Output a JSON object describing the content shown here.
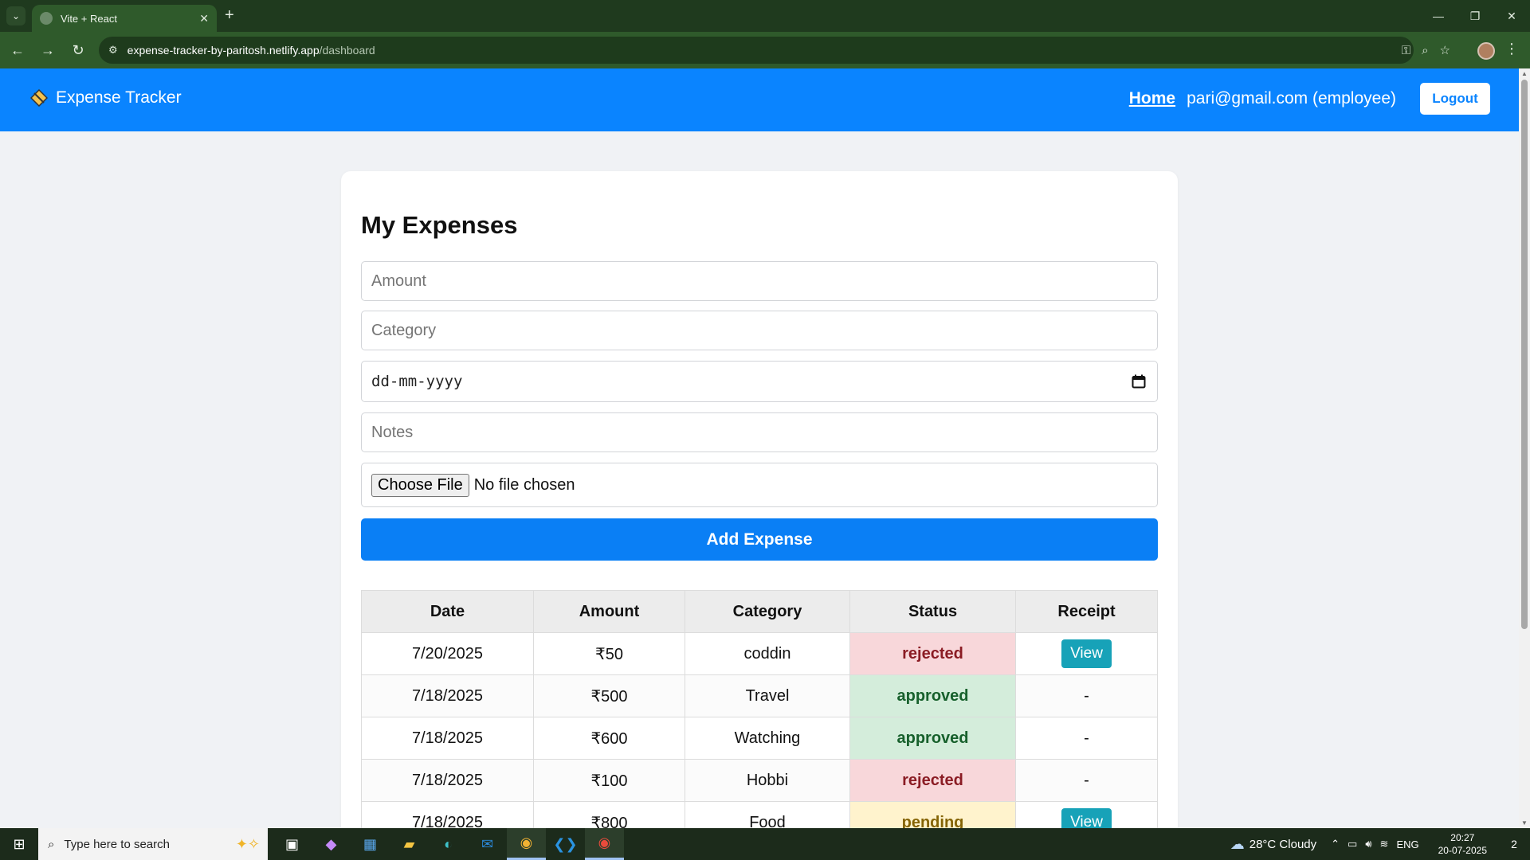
{
  "browser": {
    "tab_title": "Vite + React",
    "url_host": "expense-tracker-by-paritosh.netlify.app",
    "url_path": "/dashboard",
    "new_tab": "+",
    "tab_close": "✕",
    "min": "—",
    "restore": "❐",
    "close": "✕"
  },
  "header": {
    "brand": "Expense Tracker",
    "home_link": "Home",
    "user": "pari@gmail.com (employee)",
    "logout_label": "Logout",
    "accent": "#0a84ff"
  },
  "page": {
    "title": "My Expenses"
  },
  "form": {
    "amount_placeholder": "Amount",
    "category_placeholder": "Category",
    "date_placeholder": "dd-mm-yyyy",
    "notes_placeholder": "Notes",
    "file_button": "Choose File",
    "file_status": "No file chosen",
    "submit_label": "Add Expense"
  },
  "table": {
    "headers": [
      "Date",
      "Amount",
      "Category",
      "Status",
      "Receipt"
    ],
    "rows": [
      {
        "date": "7/20/2025",
        "amount": "₹50",
        "category": "coddin",
        "status": "rejected",
        "receipt": "View"
      },
      {
        "date": "7/18/2025",
        "amount": "₹500",
        "category": "Travel",
        "status": "approved",
        "receipt": "-"
      },
      {
        "date": "7/18/2025",
        "amount": "₹600",
        "category": "Watching",
        "status": "approved",
        "receipt": "-"
      },
      {
        "date": "7/18/2025",
        "amount": "₹100",
        "category": "Hobbi",
        "status": "rejected",
        "receipt": "-"
      },
      {
        "date": "7/18/2025",
        "amount": "₹800",
        "category": "Food",
        "status": "pending",
        "receipt": "View"
      }
    ]
  },
  "taskbar": {
    "search_placeholder": "Type here to search",
    "weather": "28°C  Cloudy",
    "lang": "ENG",
    "time": "20:27",
    "date": "20-07-2025",
    "notifications": "2"
  }
}
